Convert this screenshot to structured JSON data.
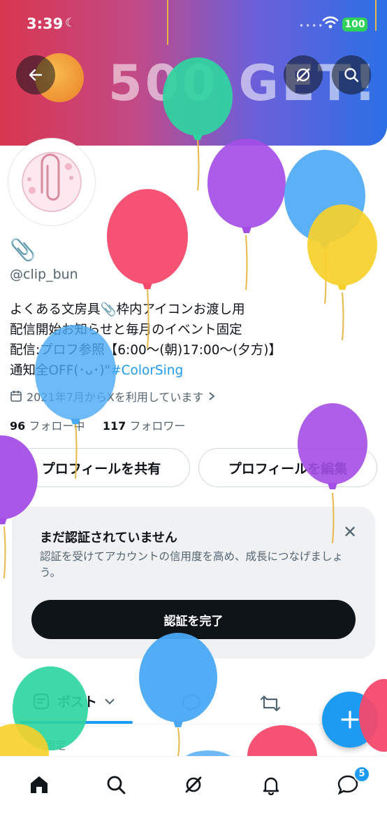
{
  "status_bar": {
    "time": "3:39",
    "battery": "100"
  },
  "banner": {
    "text": "500 GET!"
  },
  "profile": {
    "name_emoji": "📎",
    "handle": "@clip_bun",
    "bio_lines": [
      "よくある文房具📎枠内アイコンお渡し用",
      "配信開始お知らせと毎月のイベント固定",
      "配信:プロフ参照【6:00～(朝)17:00～(夕方)】"
    ],
    "bio_line4": "通知全OFF(･ᴗ･)\"",
    "hashtag": "#ColorSing",
    "joined": "2021年7月からXを利用しています",
    "following_count": "96",
    "following_label": "フォロー中",
    "followers_count": "117",
    "followers_label": "フォロワー"
  },
  "buttons": {
    "share": "プロフィールを共有",
    "edit": "プロフィールを編集"
  },
  "verify_card": {
    "title": "まだ認証されていません",
    "description": "認証を受けてアカウントの信用度を高め、成長につなげましょう。",
    "button": "認証を完了"
  },
  "tabs": {
    "posts": "ポスト"
  },
  "pinned_label": "固定",
  "notifications_badge": "5",
  "icons": [
    "back-arrow-icon",
    "grok-icon",
    "search-icon",
    "calendar-icon",
    "chevron-right-icon",
    "close-icon",
    "posts-icon",
    "chevron-down-icon",
    "speech-bubble-icon",
    "repost-icon",
    "plus-icon",
    "home-icon",
    "bell-icon",
    "messages-icon"
  ],
  "colors": {
    "accent": "#1d9bf0",
    "text": "#0f1419",
    "secondary": "#536471"
  }
}
